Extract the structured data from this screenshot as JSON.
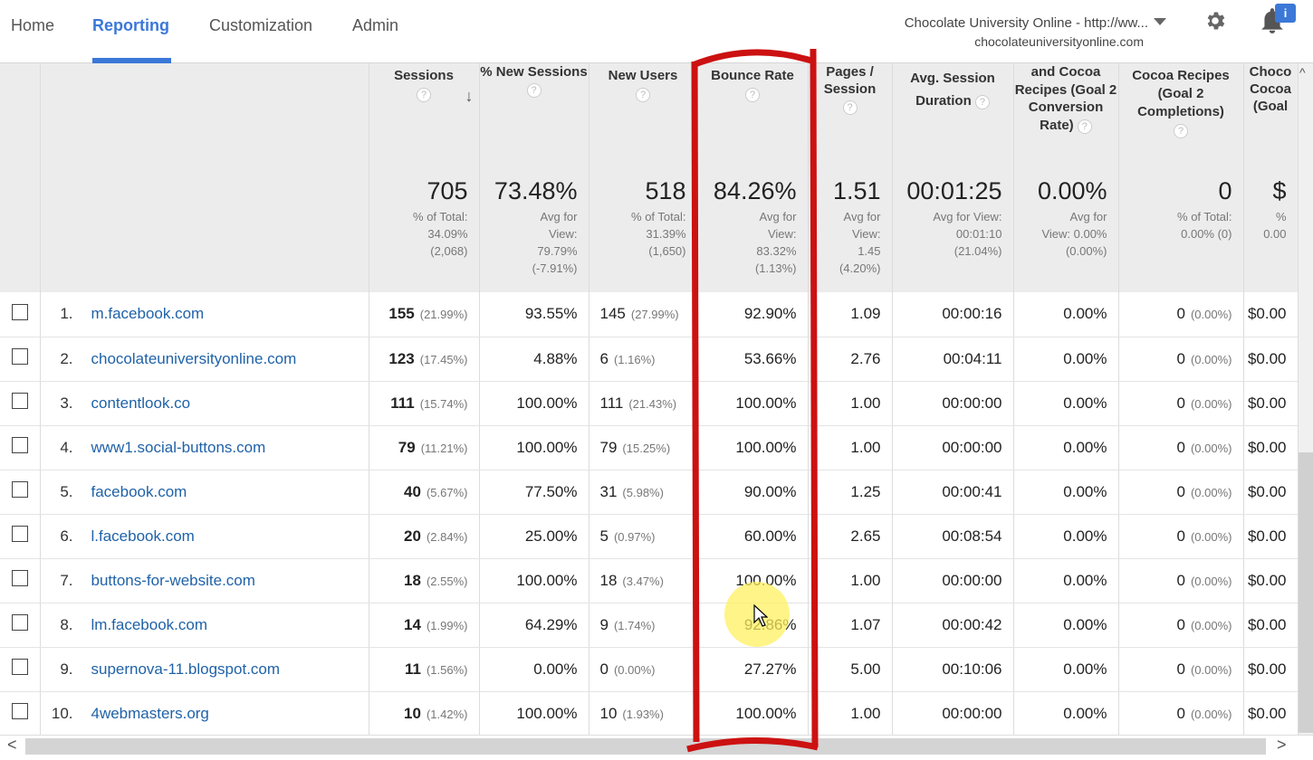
{
  "nav": {
    "tabs": [
      "Home",
      "Reporting",
      "Customization",
      "Admin"
    ],
    "active_tab": "Reporting"
  },
  "account": {
    "name": "Chocolate University Online - http://ww...",
    "url": "chocolateuniversityonline.com",
    "notification_badge": "i"
  },
  "columns": {
    "sessions": "Sessions",
    "pct_new_sessions": "% New Sessions",
    "new_users": "New Users",
    "bounce_rate": "Bounce Rate",
    "pages_session": "Pages / Session",
    "avg_session_duration": "Avg. Session Duration",
    "goal2_conv_rate": "and Cocoa Recipes (Goal 2 Conversion Rate)",
    "goal2_completions": "Cocoa Recipes (Goal 2 Completions)",
    "goal_value": "Choco Cocoa (Goal"
  },
  "totals": {
    "sessions": {
      "value": "705",
      "l1": "% of Total:",
      "l2": "34.09%",
      "l3": "(2,068)"
    },
    "pct_new_sessions": {
      "value": "73.48%",
      "l1": "Avg for",
      "l2": "View:",
      "l3": "79.79%",
      "l4": "(-7.91%)"
    },
    "new_users": {
      "value": "518",
      "l1": "% of Total:",
      "l2": "31.39%",
      "l3": "(1,650)"
    },
    "bounce_rate": {
      "value": "84.26%",
      "l1": "Avg for",
      "l2": "View:",
      "l3": "83.32%",
      "l4": "(1.13%)"
    },
    "pages_session": {
      "value": "1.51",
      "l1": "Avg for",
      "l2": "View:",
      "l3": "1.45",
      "l4": "(4.20%)"
    },
    "avg_session_duration": {
      "value": "00:01:25",
      "l1": "Avg for View:",
      "l2": "00:01:10",
      "l3": "(21.04%)"
    },
    "goal2_conv_rate": {
      "value": "0.00%",
      "l1": "Avg for",
      "l2": "View: 0.00%",
      "l3": "(0.00%)"
    },
    "goal2_completions": {
      "value": "0",
      "l1": "% of Total:",
      "l2": "0.00% (0)"
    },
    "goal_value": {
      "value": "$",
      "l1": "%",
      "l2": "0.00"
    }
  },
  "rows": [
    {
      "rank": "1.",
      "source": "m.facebook.com",
      "sessions": "155",
      "sessions_pct": "(21.99%)",
      "pct_new": "93.55%",
      "new_users": "145",
      "new_users_pct": "(27.99%)",
      "bounce": "92.90%",
      "pages": "1.09",
      "duration": "00:00:16",
      "conv": "0.00%",
      "completions": "0",
      "completions_pct": "(0.00%)",
      "value": "$0.00"
    },
    {
      "rank": "2.",
      "source": "chocolateuniversityonline.com",
      "sessions": "123",
      "sessions_pct": "(17.45%)",
      "pct_new": "4.88%",
      "new_users": "6",
      "new_users_pct": "(1.16%)",
      "bounce": "53.66%",
      "pages": "2.76",
      "duration": "00:04:11",
      "conv": "0.00%",
      "completions": "0",
      "completions_pct": "(0.00%)",
      "value": "$0.00"
    },
    {
      "rank": "3.",
      "source": "contentlook.co",
      "sessions": "111",
      "sessions_pct": "(15.74%)",
      "pct_new": "100.00%",
      "new_users": "111",
      "new_users_pct": "(21.43%)",
      "bounce": "100.00%",
      "pages": "1.00",
      "duration": "00:00:00",
      "conv": "0.00%",
      "completions": "0",
      "completions_pct": "(0.00%)",
      "value": "$0.00"
    },
    {
      "rank": "4.",
      "source": "www1.social-buttons.com",
      "sessions": "79",
      "sessions_pct": "(11.21%)",
      "pct_new": "100.00%",
      "new_users": "79",
      "new_users_pct": "(15.25%)",
      "bounce": "100.00%",
      "pages": "1.00",
      "duration": "00:00:00",
      "conv": "0.00%",
      "completions": "0",
      "completions_pct": "(0.00%)",
      "value": "$0.00"
    },
    {
      "rank": "5.",
      "source": "facebook.com",
      "sessions": "40",
      "sessions_pct": "(5.67%)",
      "pct_new": "77.50%",
      "new_users": "31",
      "new_users_pct": "(5.98%)",
      "bounce": "90.00%",
      "pages": "1.25",
      "duration": "00:00:41",
      "conv": "0.00%",
      "completions": "0",
      "completions_pct": "(0.00%)",
      "value": "$0.00"
    },
    {
      "rank": "6.",
      "source": "l.facebook.com",
      "sessions": "20",
      "sessions_pct": "(2.84%)",
      "pct_new": "25.00%",
      "new_users": "5",
      "new_users_pct": "(0.97%)",
      "bounce": "60.00%",
      "pages": "2.65",
      "duration": "00:08:54",
      "conv": "0.00%",
      "completions": "0",
      "completions_pct": "(0.00%)",
      "value": "$0.00"
    },
    {
      "rank": "7.",
      "source": "buttons-for-website.com",
      "sessions": "18",
      "sessions_pct": "(2.55%)",
      "pct_new": "100.00%",
      "new_users": "18",
      "new_users_pct": "(3.47%)",
      "bounce": "100.00%",
      "pages": "1.00",
      "duration": "00:00:00",
      "conv": "0.00%",
      "completions": "0",
      "completions_pct": "(0.00%)",
      "value": "$0.00"
    },
    {
      "rank": "8.",
      "source": "lm.facebook.com",
      "sessions": "14",
      "sessions_pct": "(1.99%)",
      "pct_new": "64.29%",
      "new_users": "9",
      "new_users_pct": "(1.74%)",
      "bounce": "92.86%",
      "pages": "1.07",
      "duration": "00:00:42",
      "conv": "0.00%",
      "completions": "0",
      "completions_pct": "(0.00%)",
      "value": "$0.00"
    },
    {
      "rank": "9.",
      "source": "supernova-11.blogspot.com",
      "sessions": "11",
      "sessions_pct": "(1.56%)",
      "pct_new": "0.00%",
      "new_users": "0",
      "new_users_pct": "(0.00%)",
      "bounce": "27.27%",
      "pages": "5.00",
      "duration": "00:10:06",
      "conv": "0.00%",
      "completions": "0",
      "completions_pct": "(0.00%)",
      "value": "$0.00"
    },
    {
      "rank": "10.",
      "source": "4webmasters.org",
      "sessions": "10",
      "sessions_pct": "(1.42%)",
      "pct_new": "100.00%",
      "new_users": "10",
      "new_users_pct": "(1.93%)",
      "bounce": "100.00%",
      "pages": "1.00",
      "duration": "00:00:00",
      "conv": "0.00%",
      "completions": "0",
      "completions_pct": "(0.00%)",
      "value": "$0.00"
    }
  ],
  "colors": {
    "accent": "#3b78d8",
    "link": "#1f62a8",
    "highlight": "#cc1111"
  }
}
